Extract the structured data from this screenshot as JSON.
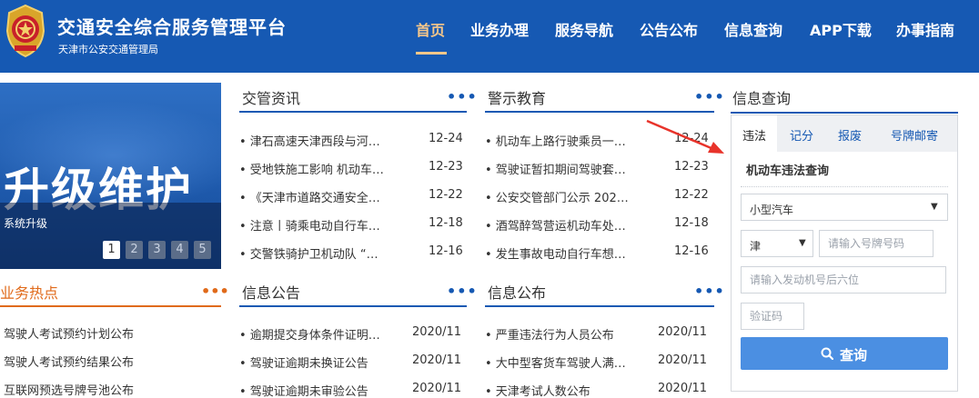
{
  "header": {
    "title": "交通安全综合服务管理平台",
    "subtitle": "天津市公安交通管理局",
    "nav": [
      "首页",
      "业务办理",
      "服务导航",
      "公告公布",
      "信息查询",
      "APP下载",
      "办事指南"
    ],
    "active_nav": "首页"
  },
  "banner": {
    "title": "升级维护",
    "caption": "系统升级",
    "pages": [
      "1",
      "2",
      "3",
      "4",
      "5"
    ],
    "active_page": "1"
  },
  "news": {
    "title": "交管资讯",
    "more": "•••",
    "items": [
      {
        "text": "• 津石高速天津西段与河…",
        "date": "12-24"
      },
      {
        "text": "• 受地铁施工影响 机动车…",
        "date": "12-23"
      },
      {
        "text": "• 《天津市道路交通安全…",
        "date": "12-22"
      },
      {
        "text": "• 注意丨骑乘电动自行车…",
        "date": "12-18"
      },
      {
        "text": "• 交警铁骑护卫机动队 “…",
        "date": "12-16"
      }
    ]
  },
  "warning": {
    "title": "警示教育",
    "more": "•••",
    "items": [
      {
        "text": "• 机动车上路行驶乘员一…",
        "date": "12-24"
      },
      {
        "text": "• 驾驶证暂扣期间驾驶套…",
        "date": "12-23"
      },
      {
        "text": "• 公安交管部门公示 202…",
        "date": "12-22"
      },
      {
        "text": "• 酒驾醉驾营运机动车处…",
        "date": "12-18"
      },
      {
        "text": "• 发生事故电动自行车想…",
        "date": "12-16"
      }
    ]
  },
  "notice": {
    "title": "信息公告",
    "more": "•••",
    "items": [
      {
        "text": "• 逾期提交身体条件证明…",
        "date": "2020/11"
      },
      {
        "text": "• 驾驶证逾期未换证公告",
        "date": "2020/11"
      },
      {
        "text": "• 驾驶证逾期未审验公告",
        "date": "2020/11"
      }
    ]
  },
  "publish": {
    "title": "信息公布",
    "more": "•••",
    "items": [
      {
        "text": "• 严重违法行为人员公布",
        "date": "2020/11"
      },
      {
        "text": "• 大中型客货车驾驶人满…",
        "date": "2020/11"
      },
      {
        "text": "• 天津考试人数公布",
        "date": "2020/11"
      }
    ]
  },
  "hot": {
    "title": "业务热点",
    "more": "•••",
    "items": [
      "驾驶人考试预约计划公布",
      "驾驶人考试预约结果公布",
      "互联网预选号牌号池公布"
    ]
  },
  "query": {
    "title": "信息查询",
    "tabs": [
      "违法",
      "记分",
      "报废",
      "号牌邮寄"
    ],
    "active_tab": "违法",
    "subtitle": "机动车违法查询",
    "vehicle_type": "小型汽车",
    "province": "津",
    "plate_placeholder": "请输入号牌号码",
    "engine_placeholder": "请输入发动机号后六位",
    "captcha_placeholder": "验证码",
    "button": "查询"
  },
  "colors": {
    "header_bg": "#1659b3",
    "nav_active": "#f6c78a",
    "hot_accent": "#e06a1a",
    "query_button": "#4b8fe2",
    "annotation_arrow": "#e8332a"
  }
}
